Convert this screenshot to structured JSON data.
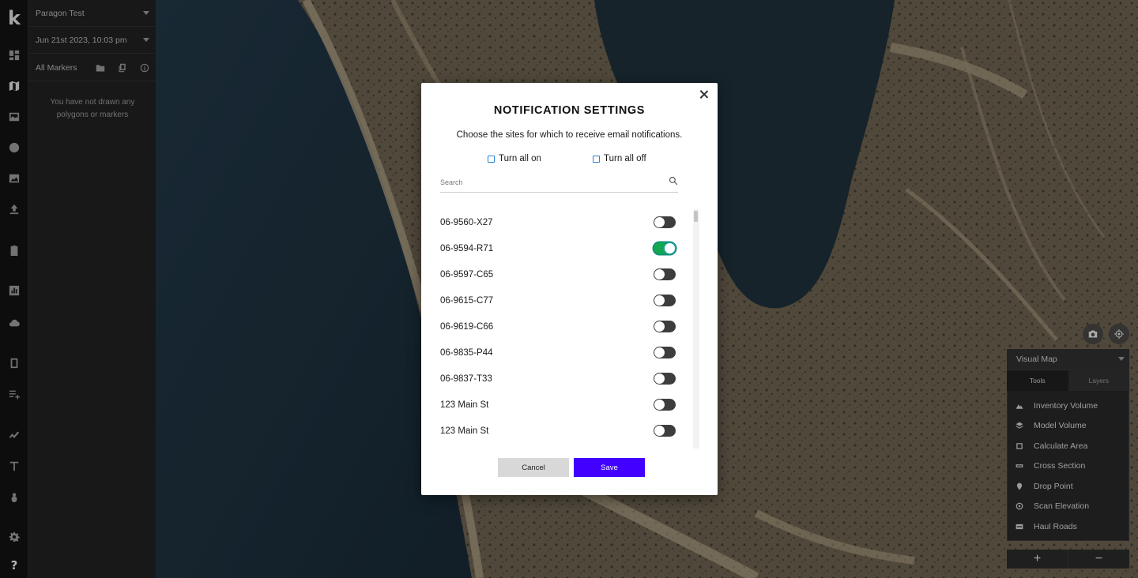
{
  "sidebar": {
    "logo": "k",
    "nav_icons": [
      "dashboard-icon",
      "map-icon",
      "image-icon",
      "globe-icon",
      "photo-icon",
      "upload-icon",
      "clipboard-icon",
      "chart-icon",
      "cloud-upload-icon",
      "book-icon",
      "list-add-icon",
      "trend-icon",
      "antenna-icon",
      "bug-icon",
      "gear-icon",
      "help-icon"
    ],
    "help": "?"
  },
  "panel": {
    "project": "Paragon Test",
    "date": "Jun 21st 2023, 10:03 pm",
    "markers_label": "All Markers",
    "empty_message": "You have not drawn any polygons or markers"
  },
  "map_controls": {
    "view_select": "Visual Map",
    "tabs": [
      "Tools",
      "Layers"
    ],
    "active_tab": "Tools",
    "tools": [
      {
        "label": "Inventory Volume",
        "icon": "mountain-icon"
      },
      {
        "label": "Model Volume",
        "icon": "layers-icon"
      },
      {
        "label": "Calculate Area",
        "icon": "square-icon"
      },
      {
        "label": "Cross Section",
        "icon": "ruler-icon"
      },
      {
        "label": "Drop Point",
        "icon": "pin-icon"
      },
      {
        "label": "Scan Elevation",
        "icon": "target-icon"
      },
      {
        "label": "Haul Roads",
        "icon": "road-icon"
      }
    ],
    "zoom_in": "+",
    "zoom_out": "−"
  },
  "modal": {
    "title": "NOTIFICATION SETTINGS",
    "subtitle": "Choose the sites for which to receive email notifications.",
    "turn_all_on": "Turn all on",
    "turn_all_off": "Turn all off",
    "search_placeholder": "Search",
    "sites": [
      {
        "name": "06-9560-X27",
        "enabled": false
      },
      {
        "name": "06-9594-R71",
        "enabled": true
      },
      {
        "name": "06-9597-C65",
        "enabled": false
      },
      {
        "name": "06-9615-C77",
        "enabled": false
      },
      {
        "name": "06-9619-C66",
        "enabled": false
      },
      {
        "name": "06-9835-P44",
        "enabled": false
      },
      {
        "name": "06-9837-T33",
        "enabled": false
      },
      {
        "name": "123 Main St",
        "enabled": false
      },
      {
        "name": "123 Main St",
        "enabled": false
      }
    ],
    "cancel_label": "Cancel",
    "save_label": "Save",
    "colors": {
      "save": "#4100ff",
      "toggle_on": "#14a650",
      "checkbox": "#2a7fd4"
    }
  }
}
